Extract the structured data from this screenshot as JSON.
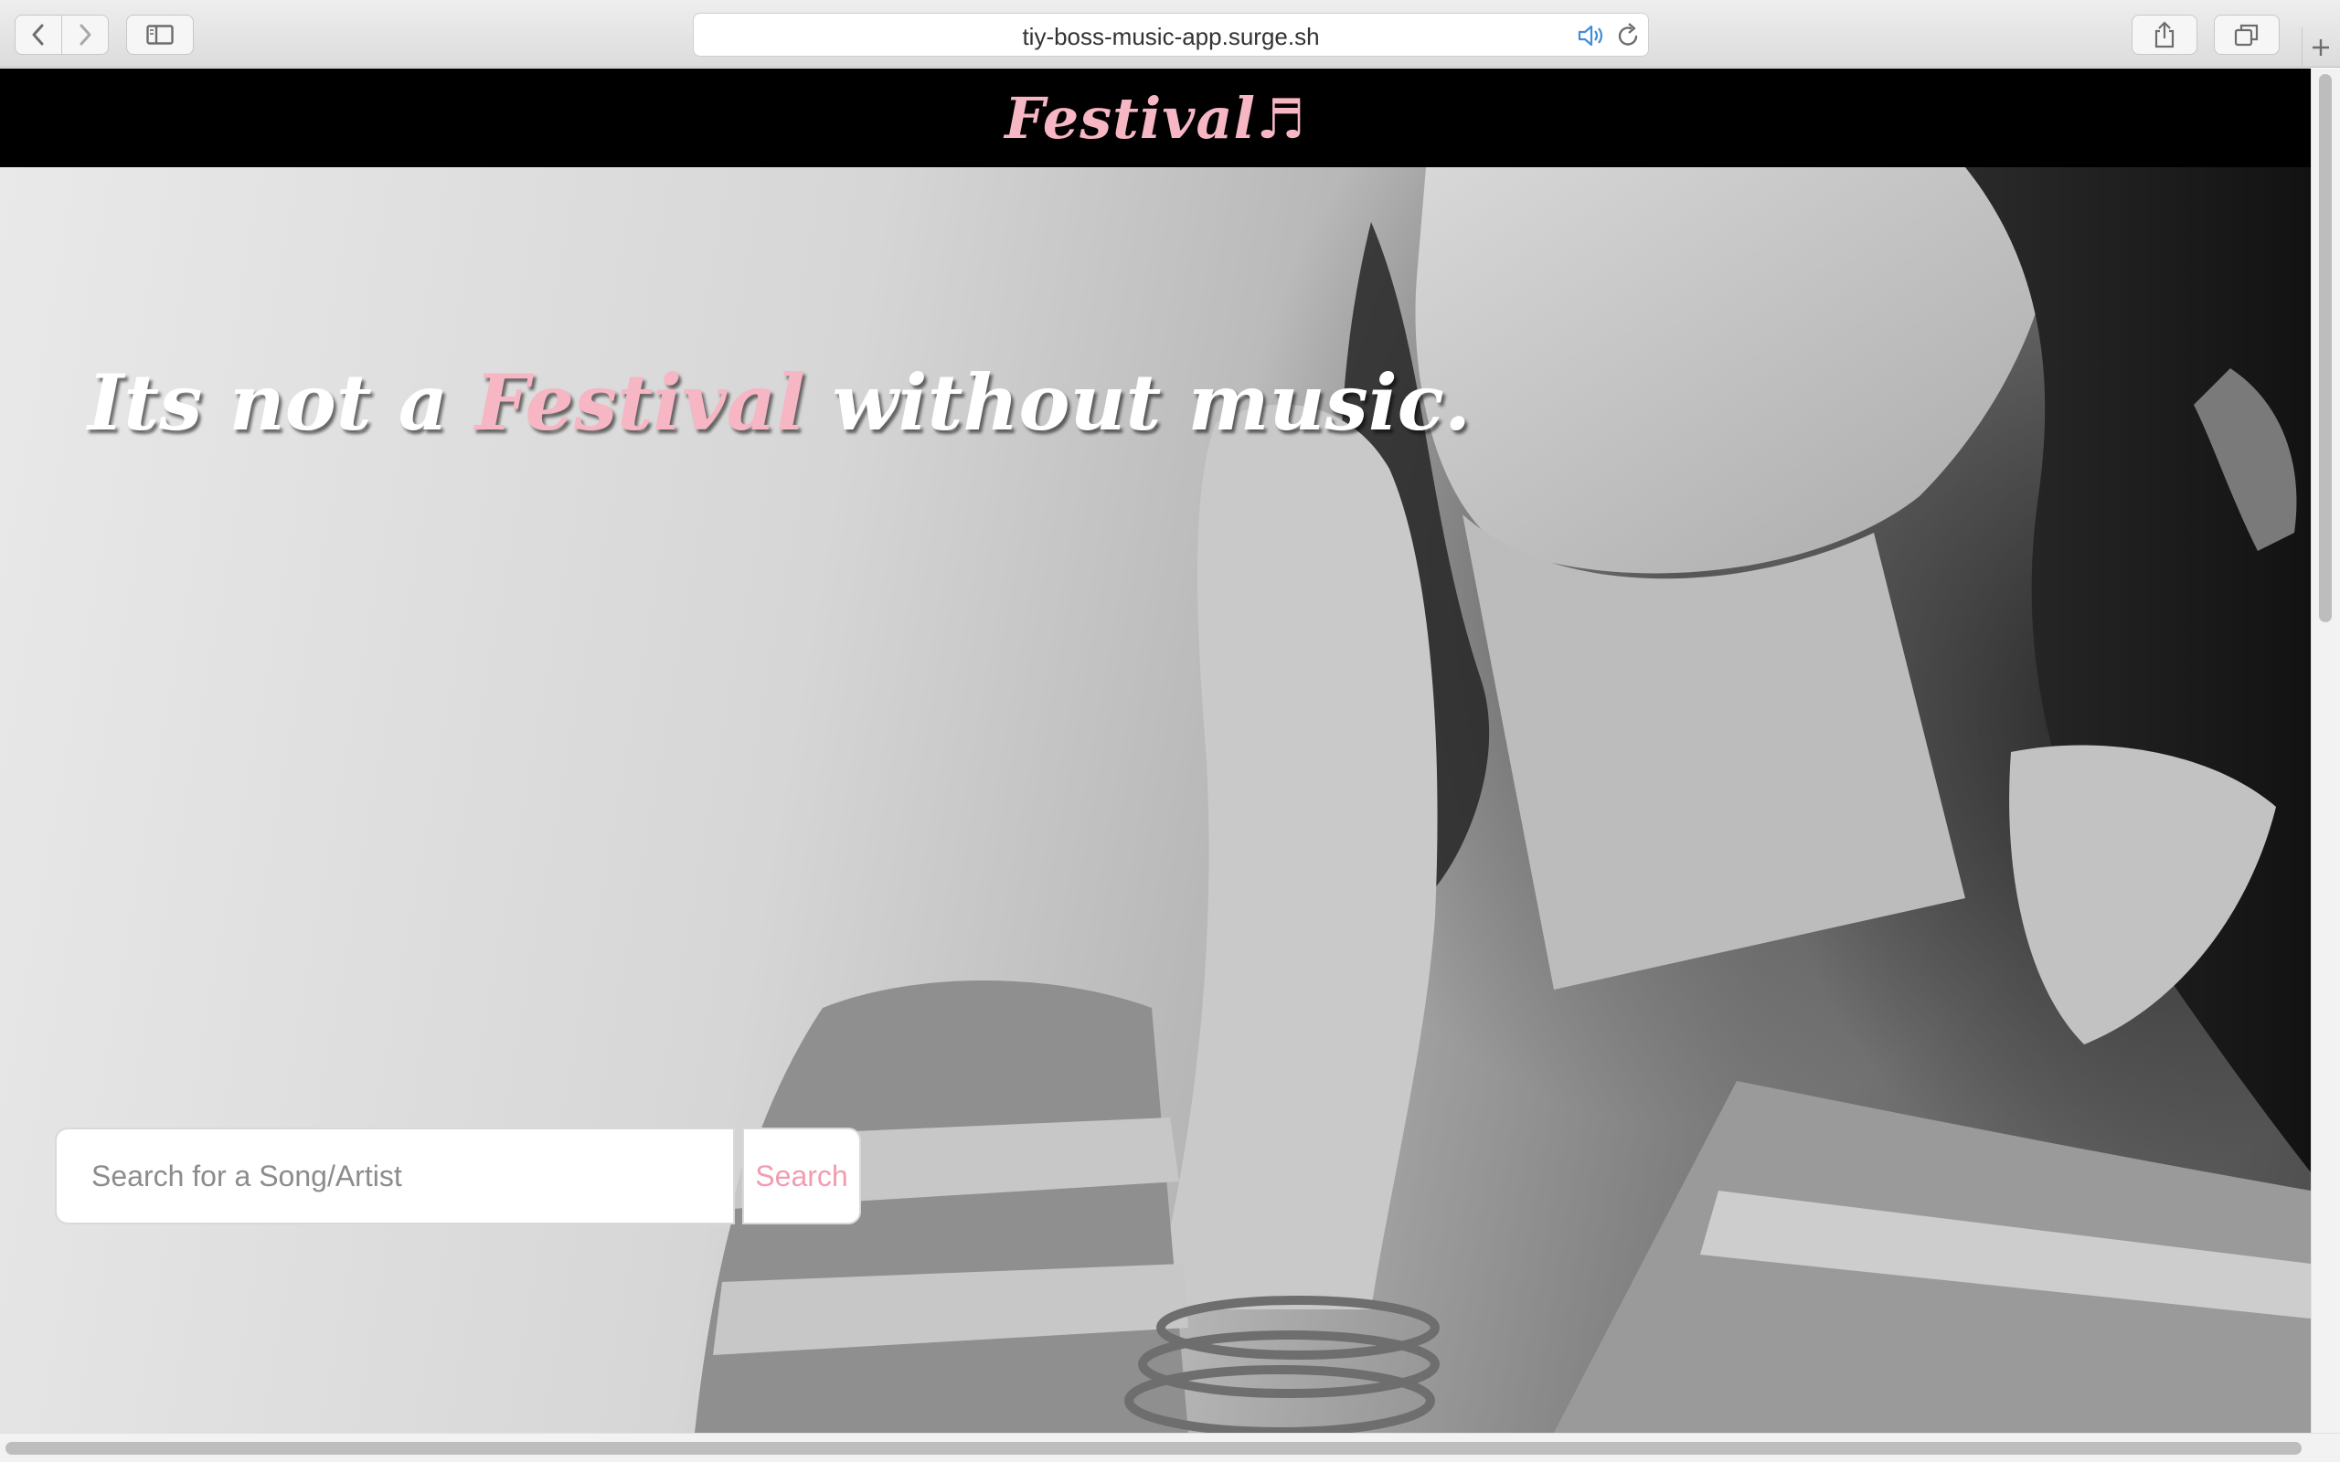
{
  "browser": {
    "url": "tiy-boss-music-app.surge.sh",
    "back_icon": "chevron-left-icon",
    "forward_icon": "chevron-right-icon",
    "sidebar_icon": "sidebar-icon",
    "audio_icon": "speaker-icon",
    "reload_icon": "reload-icon",
    "share_icon": "share-icon",
    "tabs_icon": "tabs-overview-icon",
    "new_tab_icon": "plus-icon"
  },
  "header": {
    "brand": "Festival",
    "brand_symbol": "♬"
  },
  "hero": {
    "tagline_before": "Its not a",
    "tagline_accent": "Festival",
    "tagline_after": "without music."
  },
  "search": {
    "placeholder": "Search for a Song/Artist",
    "value": "",
    "button_label": "Search"
  },
  "colors": {
    "brand_pink": "#f7b6c4",
    "header_bg": "#000000",
    "search_button_text": "#f29cb0"
  }
}
